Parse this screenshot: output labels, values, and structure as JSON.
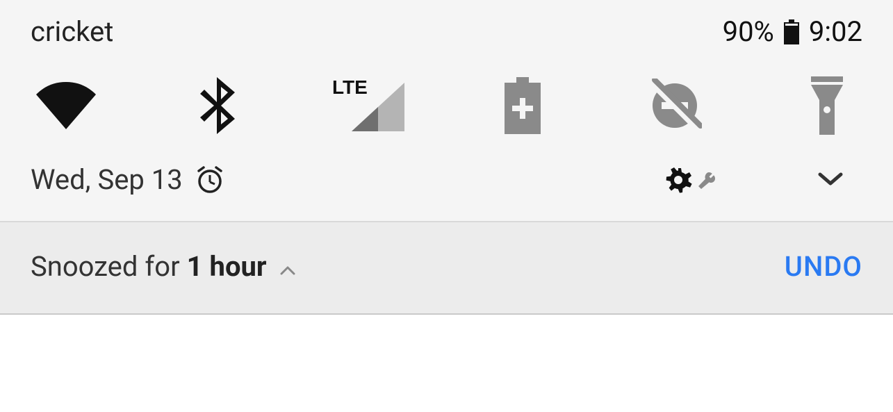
{
  "status": {
    "carrier": "cricket",
    "battery_pct": "90%",
    "time": "9:02"
  },
  "quick_settings": {
    "tiles": [
      {
        "name": "wifi",
        "active": true
      },
      {
        "name": "bluetooth",
        "active": true
      },
      {
        "name": "cellular",
        "active": false,
        "label": "LTE"
      },
      {
        "name": "battery-saver",
        "active": false
      },
      {
        "name": "do-not-disturb",
        "active": false
      },
      {
        "name": "flashlight",
        "active": false
      }
    ]
  },
  "info": {
    "date": "Wed, Sep 13"
  },
  "snooze": {
    "prefix": "Snoozed for",
    "duration": "1 hour",
    "undo_label": "UNDO"
  },
  "colors": {
    "active": "#111111",
    "inactive": "#8a8a8a",
    "accent": "#2a7af2",
    "panel_bg": "#ececec",
    "shade_bg": "#f5f5f5"
  }
}
